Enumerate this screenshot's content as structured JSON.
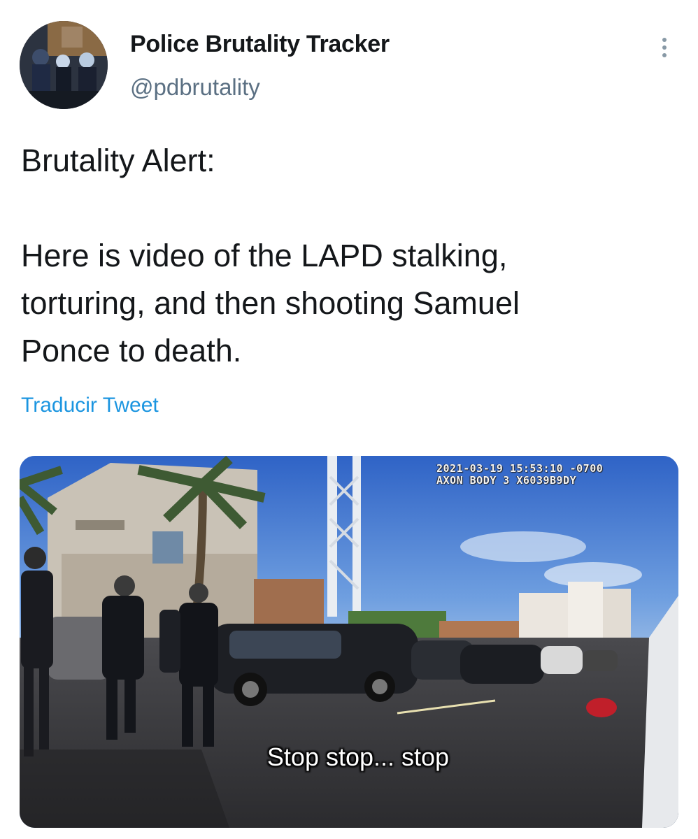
{
  "author": {
    "display_name": "Police Brutality Tracker",
    "handle": "@pdbrutality"
  },
  "tweet": {
    "text": "Brutality Alert:\n\nHere is video of the LAPD stalking,\ntorturing, and then shooting Samuel\nPonce to death.",
    "translate_label": "Traducir Tweet"
  },
  "media": {
    "timestamp": "2021-03-19 15:53:10 -0700",
    "device": "AXON BODY 3 X6039B9DY",
    "caption": "Stop stop... stop"
  },
  "colors": {
    "link": "#1b95e0",
    "secondary_text": "#5b7083",
    "primary_text": "#14171a"
  },
  "icons": {
    "menu": "more-vertical-icon",
    "camera_brand": "axon-logo-icon"
  }
}
